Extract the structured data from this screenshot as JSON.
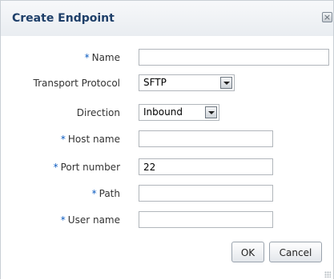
{
  "dialog": {
    "title": "Create Endpoint",
    "close_icon": "close-icon"
  },
  "form": {
    "name": {
      "label": "Name",
      "required": "*",
      "value": ""
    },
    "transport_protocol": {
      "label": "Transport Protocol",
      "value": "SFTP"
    },
    "direction": {
      "label": "Direction",
      "value": "Inbound"
    },
    "host_name": {
      "label": "Host name",
      "required": "*",
      "value": ""
    },
    "port_number": {
      "label": "Port number",
      "required": "*",
      "value": "22"
    },
    "path": {
      "label": "Path",
      "required": "*",
      "value": ""
    },
    "user_name": {
      "label": "User name",
      "required": "*",
      "value": ""
    }
  },
  "buttons": {
    "ok": "OK",
    "cancel": "Cancel"
  },
  "colors": {
    "title": "#1e3f69",
    "required_marker": "#0b5bc0"
  }
}
